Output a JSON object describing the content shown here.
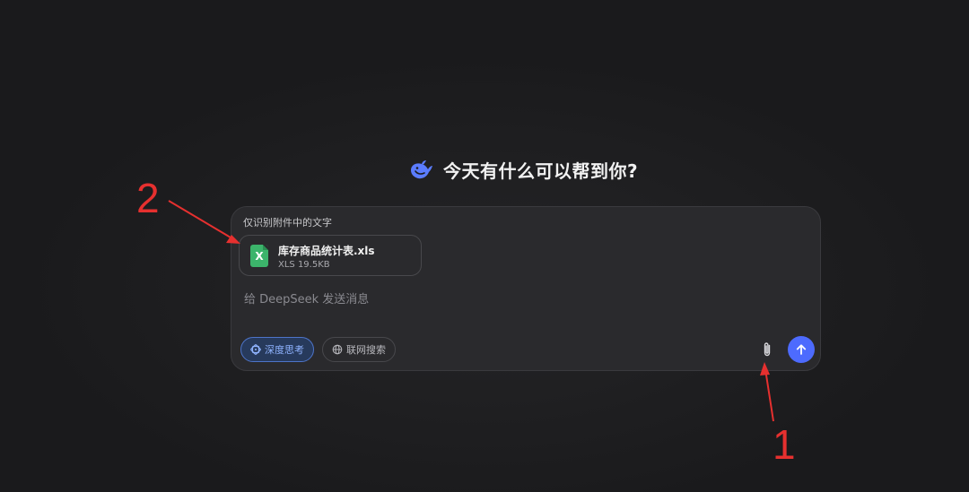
{
  "greeting": {
    "title": "今天有什么可以帮到你?"
  },
  "chat": {
    "attachment_notice": "仅识别附件中的文字",
    "attachment": {
      "icon_letter": "X",
      "name": "库存商品统计表.xls",
      "meta": "XLS 19.5KB"
    },
    "input": {
      "placeholder": "给 DeepSeek 发送消息",
      "value": ""
    },
    "deep_think_label": "深度思考",
    "web_search_label": "联网搜索"
  },
  "annotations": {
    "one": "1",
    "two": "2"
  },
  "colors": {
    "background": "#1c1c1e",
    "panel": "#2a2a2d",
    "accent": "#4d6bfe",
    "deep_think": "#8fb3ff",
    "excel_green": "#3cb46b",
    "annotation_red": "#e6302f"
  },
  "icons": {
    "logo": "whale-logo-icon",
    "attach": "paperclip-icon",
    "send": "arrow-up-icon",
    "deep_think": "atom-icon",
    "web_search": "globe-icon"
  }
}
